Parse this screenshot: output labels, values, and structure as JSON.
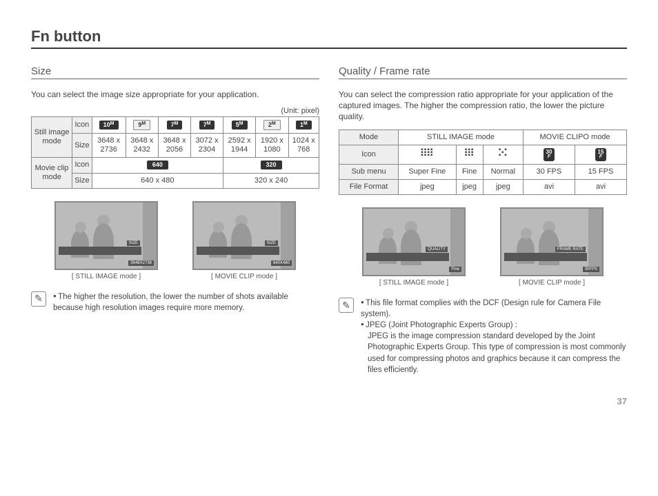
{
  "title": "Fn button",
  "page_number": "37",
  "left": {
    "heading": "Size",
    "lead": "You can select the image size appropriate for your application.",
    "unit": "(Unit: pixel)",
    "table": {
      "still_label": "Still image mode",
      "movie_label": "Movie clip mode",
      "rows": {
        "icon": "Icon",
        "size": "Size"
      },
      "still_icons": [
        "10M",
        "9M",
        "7M",
        "7M",
        "5M",
        "2M",
        "1M"
      ],
      "still_sizes": [
        "3648 x 2736",
        "3648 x 2432",
        "3648 x 2056",
        "3072 x 2304",
        "2592 x 1944",
        "1920 x 1080",
        "1024 x 768"
      ],
      "movie_icons": [
        "640",
        "320"
      ],
      "movie_sizes": [
        "640 x 480",
        "320 x 240"
      ]
    },
    "preview_still_caption": "[ STILL IMAGE mode ]",
    "preview_movie_caption": "[ MOVIE CLIP mode ]",
    "screen_label": "SIZE",
    "screen_value_still": "3648X2736",
    "screen_value_movie": "640X480",
    "note": "The higher the resolution, the lower the number of shots available because high resolution images require more memory."
  },
  "right": {
    "heading": "Quality / Frame rate",
    "lead": "You can select the compression ratio appropriate for your application of the captured images. The higher the compression ratio, the lower the picture quality.",
    "table": {
      "headers": {
        "mode": "Mode",
        "still": "STILL IMAGE mode",
        "movie": "MOVIE CLIPO mode",
        "icon": "Icon",
        "submenu": "Sub menu",
        "format": "File Format"
      },
      "submenu": [
        "Super Fine",
        "Fine",
        "Normal",
        "30 FPS",
        "15 FPS"
      ],
      "format": [
        "jpeg",
        "jpeg",
        "jpeg",
        "avi",
        "avi"
      ],
      "fps_icons": [
        "30",
        "15"
      ]
    },
    "preview_still_caption": "[ STILL IMAGE mode ]",
    "preview_movie_caption": "[ MOVIE CLIP mode ]",
    "screen_label_quality": "QUALITY",
    "screen_value_quality": "Fine",
    "screen_label_rate": "FRAME RATE",
    "screen_value_rate": "30FPS",
    "notes": {
      "a": "This file format complies with the DCF (Design rule for Camera File system).",
      "b_head": "JPEG (Joint Photographic Experts Group) :",
      "b_body": "JPEG is the image compression standard developed by the Joint Photographic Experts Group. This type of compression is most commonly used for compressing photos and graphics because it can compress the files efficiently."
    }
  }
}
